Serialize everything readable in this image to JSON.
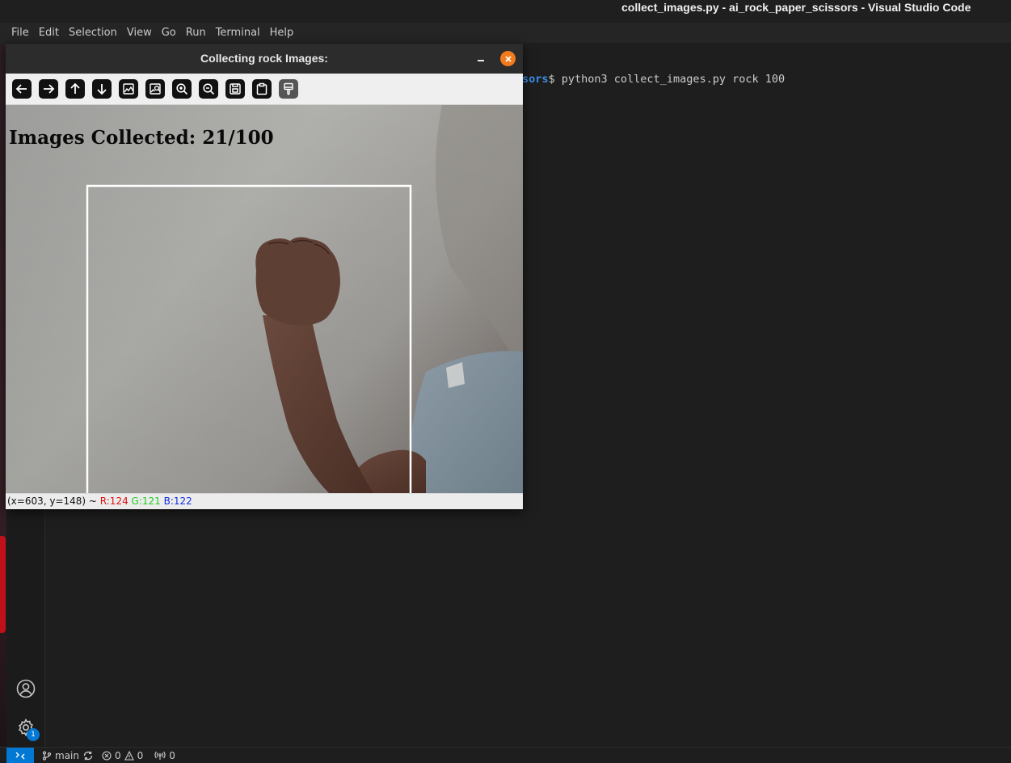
{
  "window": {
    "title": "collect_images.py - ai_rock_paper_scissors - Visual Studio Code"
  },
  "menu": {
    "items": [
      "File",
      "Edit",
      "Selection",
      "View",
      "Go",
      "Run",
      "Terminal",
      "Help"
    ]
  },
  "terminal": {
    "prompt_path_fragment": "sors",
    "command": "$ python3 collect_images.py rock 100"
  },
  "activity_bar": {
    "icons": [
      "account-icon",
      "settings-gear-icon"
    ],
    "settings_badge": "1"
  },
  "status_bar": {
    "branch": "main",
    "errors": "0",
    "warnings": "0",
    "ports": "0"
  },
  "cv_window": {
    "title": "Collecting rock Images:",
    "toolbar_icons": [
      "arrow-left-icon",
      "arrow-right-icon",
      "arrow-up-icon",
      "arrow-down-icon",
      "image-icon",
      "image-properties-icon",
      "zoom-in-icon",
      "zoom-out-icon",
      "save-icon",
      "copy-clipboard-icon",
      "paint-brush-icon"
    ],
    "overlay_text": "Images Collected: 21/100",
    "status": {
      "coords": "(x=603, y=148) ~ ",
      "r": "R:124",
      "g": "G:121",
      "b": "B:122"
    },
    "colors": {
      "close_button": "#f37b1d",
      "red_channel": "#e01010",
      "green_channel": "#22cc22",
      "blue_channel": "#1030e0"
    }
  }
}
